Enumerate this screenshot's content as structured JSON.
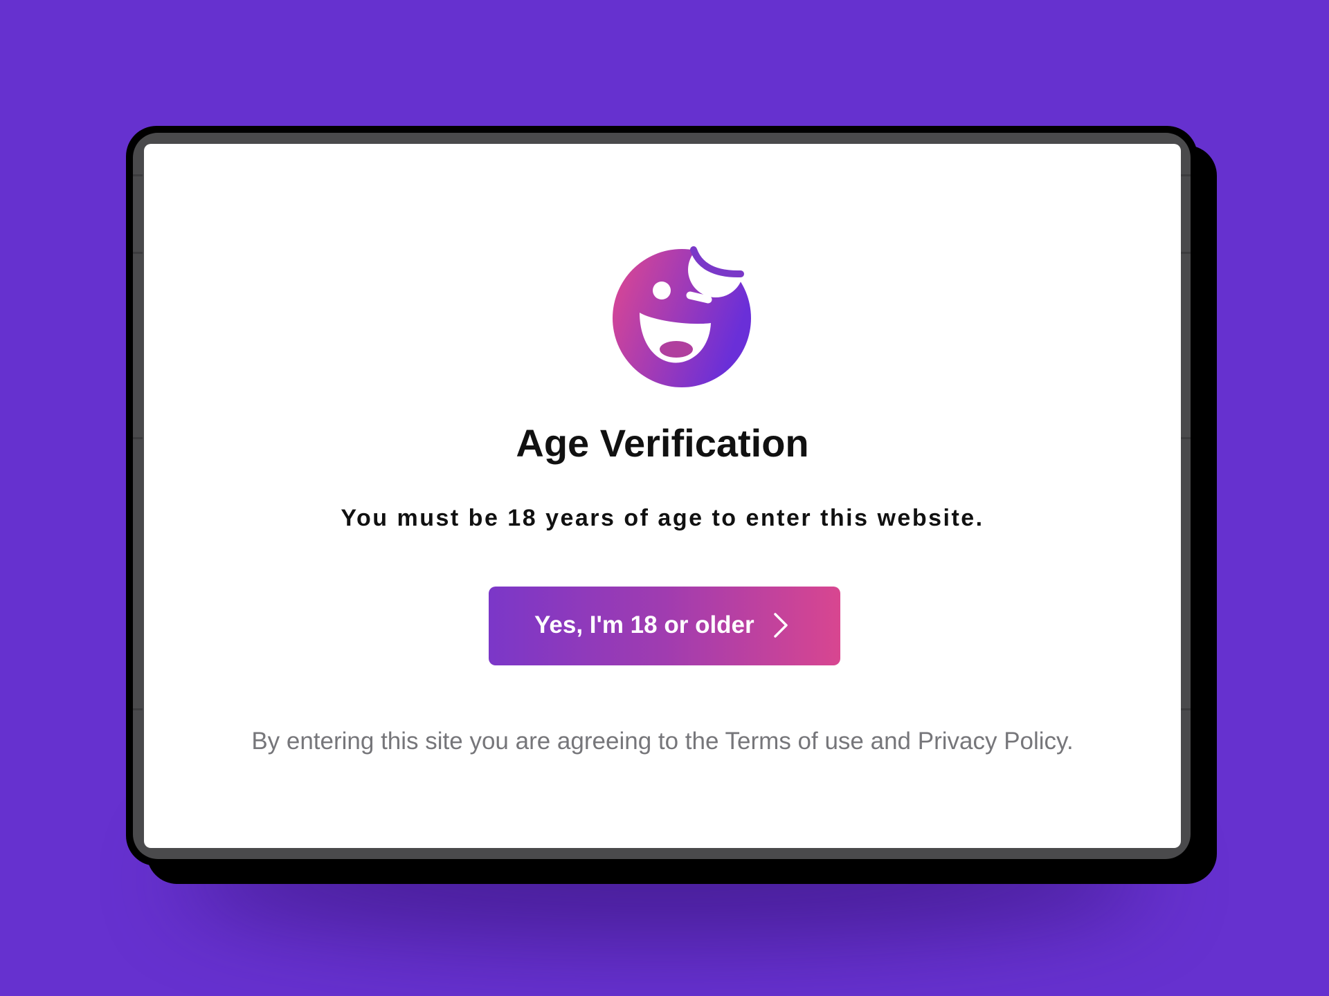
{
  "modal": {
    "title": "Age Verification",
    "subtitle": "You must be 18 years of age to enter this website.",
    "confirm_button_label": "Yes, I'm 18 or older",
    "footer_text": "By entering this site you are agreeing to the Terms of use and Privacy Policy."
  },
  "icons": {
    "logo": "winking-face-icon",
    "button_arrow": "chevron-right-icon"
  },
  "colors": {
    "background": "#6631cf",
    "gradient_start": "#7b37c8",
    "gradient_end": "#d84690",
    "logo_pink": "#e0488f",
    "logo_purple": "#6a2fd8",
    "text_dark": "#111111",
    "text_muted": "#76767a"
  }
}
